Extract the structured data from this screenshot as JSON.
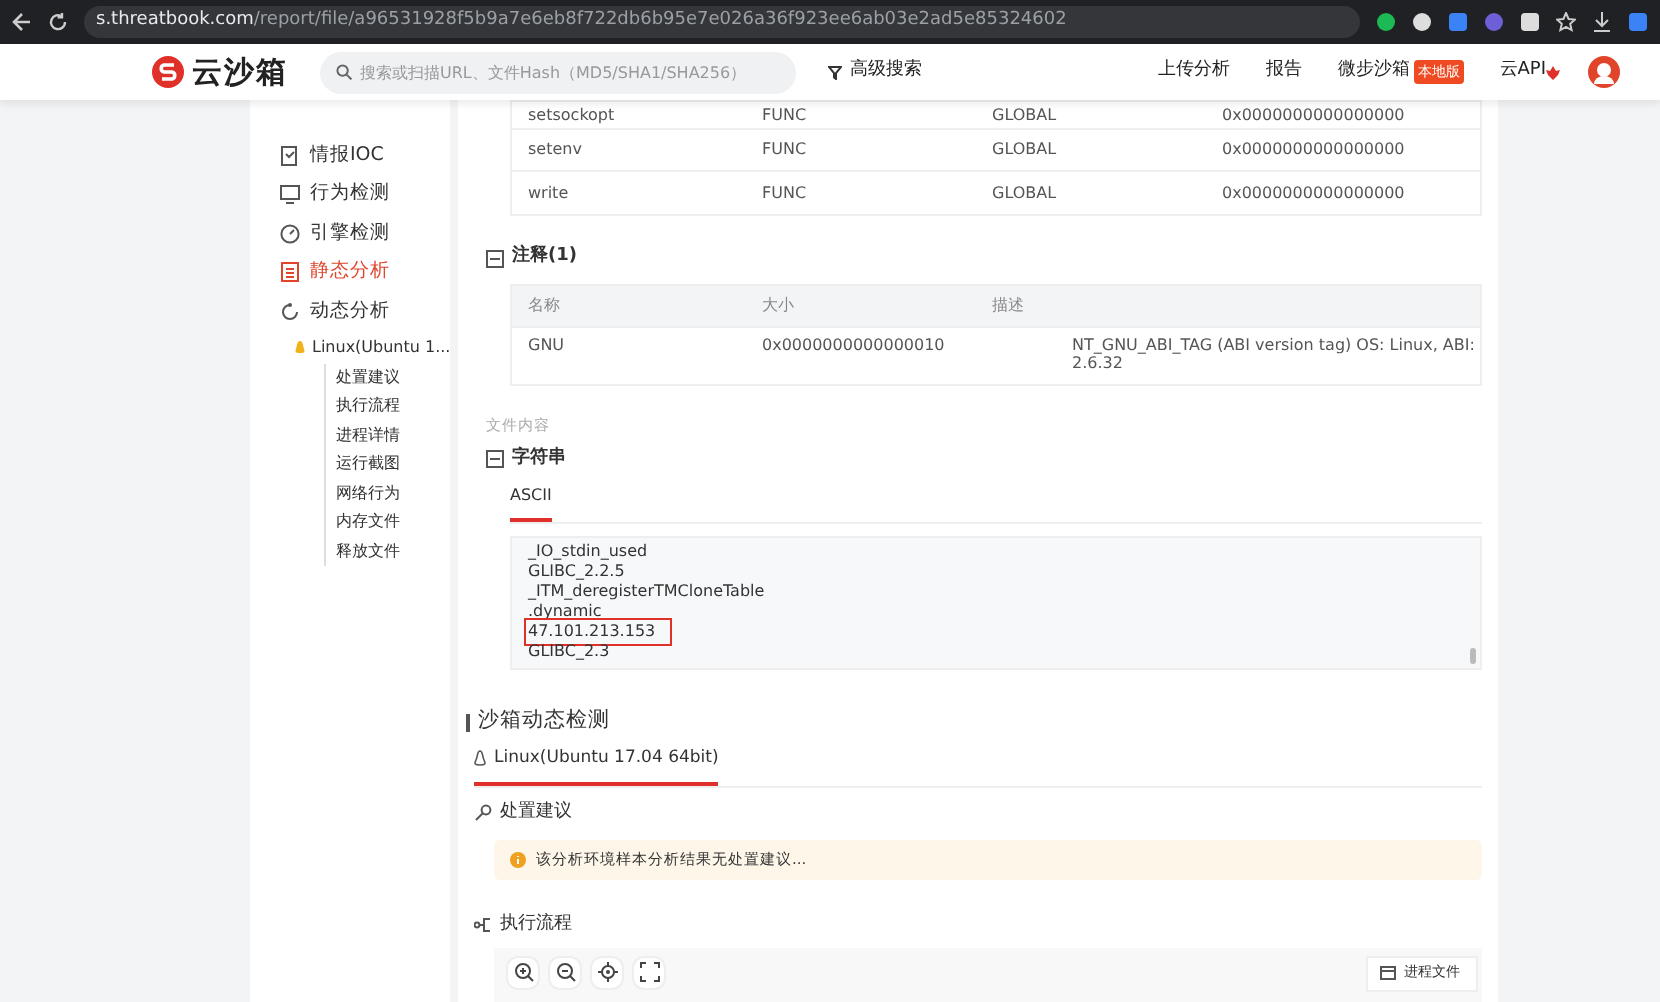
{
  "browser": {
    "url": "**s.threatbook.com**/report/file/a96531928f5b9a7e6eb8f722db6b95e7e026a36f923ee6ab03e2ad5e85324602"
  },
  "header": {
    "logo_text": "云沙箱",
    "search": {
      "placeholder": "搜索或扫描URL、文件Hash（MD5/SHA1/SHA256）"
    },
    "advanced_search": "高级搜索",
    "nav": [
      {
        "label": "上传分析"
      },
      {
        "label": "报告"
      },
      {
        "label": "微步沙箱",
        "badge": "本地版"
      },
      {
        "label": "云API"
      }
    ]
  },
  "sidebar": {
    "items": [
      {
        "label": "情报IOC",
        "selected": false
      },
      {
        "label": "行为检测",
        "selected": false
      },
      {
        "label": "引擎检测",
        "selected": false
      },
      {
        "label": "静态分析",
        "selected": true
      },
      {
        "label": "动态分析",
        "selected": false,
        "children": [
          {
            "label": "Linux(Ubuntu 1...",
            "expanded": true,
            "children": [
              {
                "label": "处置建议"
              },
              {
                "label": "执行流程"
              },
              {
                "label": "进程详情"
              },
              {
                "label": "运行截图"
              },
              {
                "label": "网络行为"
              },
              {
                "label": "内存文件"
              },
              {
                "label": "释放文件"
              }
            ]
          }
        ]
      }
    ]
  },
  "symbols_table": {
    "rows": [
      [
        "setsockopt",
        "FUNC",
        "GLOBAL",
        "0x0000000000000000"
      ],
      [
        "setenv",
        "FUNC",
        "GLOBAL",
        "0x0000000000000000"
      ],
      [
        "write",
        "FUNC",
        "GLOBAL",
        "0x0000000000000000"
      ]
    ]
  },
  "notes": {
    "title": "注释(1)",
    "expanded": true,
    "columns": [
      "名称",
      "大小",
      "描述"
    ],
    "rows": [
      [
        "GNU",
        "0x0000000000000010",
        "NT_GNU_ABI_TAG (ABI version tag) OS: Linux, ABI: 2.6.32"
      ]
    ]
  },
  "file_content_label": "文件内容",
  "strings": {
    "title": "字符串",
    "expanded": true,
    "tabs": [
      {
        "label": "ASCII",
        "selected": true
      }
    ],
    "lines": [
      {
        "text": "_IO_stdin_used",
        "highlighted": false
      },
      {
        "text": "GLIBC_2.2.5",
        "highlighted": false
      },
      {
        "text": "_ITM_deregisterTMCloneTable",
        "highlighted": false
      },
      {
        "text": ".dynamic",
        "highlighted": false
      },
      {
        "text": "47.101.213.153",
        "highlighted": true
      },
      {
        "text": "GLIBC_2.3",
        "highlighted": false
      }
    ]
  },
  "dynamic": {
    "title": "沙箱动态检测",
    "env_tabs": [
      {
        "label": "Linux(Ubuntu 17.04 64bit)",
        "selected": true
      }
    ],
    "advice": {
      "title": "处置建议",
      "alert": "该分析环境样本分析结果无处置建议..."
    },
    "flow": {
      "title": "执行流程",
      "legend": [
        "进程文件"
      ]
    }
  }
}
